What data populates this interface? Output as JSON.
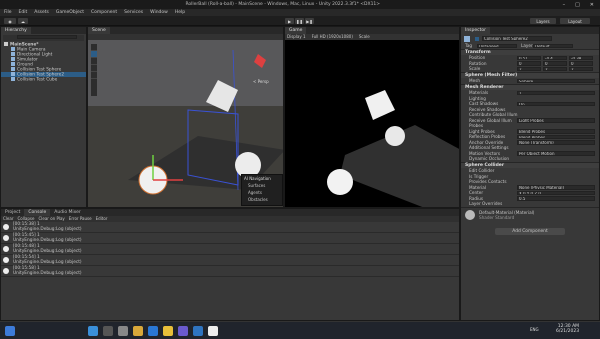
{
  "window": {
    "title": "RollerBall (Roll-a-ball) - MainScene - Windows, Mac, Linux - Unity 2022.3.3f1* <DX11>"
  },
  "menu": [
    "File",
    "Edit",
    "Assets",
    "GameObject",
    "Component",
    "Services",
    "Window",
    "Help"
  ],
  "toolbar": {
    "account": "Layers",
    "layout": "Layout"
  },
  "hierarchy": {
    "tab": "Hierarchy",
    "scene": "MainScene*",
    "items": [
      "Main Camera",
      "Directional Light",
      "Simulator",
      "Ground",
      "Collision Test Sphere",
      "Collision Test Sphere2",
      "Collision Test Cube"
    ],
    "selected": 5
  },
  "scene_view": {
    "tab": "Scene",
    "persp": "< Persp",
    "nav_overlay": {
      "title": "AI Navigation",
      "items": [
        "Surfaces",
        "Agents",
        "Obstacles"
      ]
    }
  },
  "game_view": {
    "tab": "Game",
    "display": "Display 1",
    "res": "Full HD (1920x1080)",
    "scale": "Scale"
  },
  "console": {
    "tabs": [
      "Project",
      "Console",
      "Audio Mixer"
    ],
    "toolbar": [
      "Clear",
      "Collapse",
      "Clear on Play",
      "Error Pause",
      "Editor"
    ],
    "logs": [
      {
        "time": "[00:15:38] 1",
        "msg": "UnityEngine.Debug:Log (object)"
      },
      {
        "time": "[00:15:45] 1",
        "msg": "UnityEngine.Debug:Log (object)"
      },
      {
        "time": "[00:15:48] 1",
        "msg": "UnityEngine.Debug:Log (object)"
      },
      {
        "time": "[00:15:54] 1",
        "msg": "UnityEngine.Debug:Log (object)"
      },
      {
        "time": "[00:15:58] 1",
        "msg": "UnityEngine.Debug:Log (object)"
      }
    ]
  },
  "inspector": {
    "tab": "Inspector",
    "object_name": "Collision Test Sphere2",
    "tag": "Untagged",
    "layer": "Default",
    "transform": {
      "title": "Transform",
      "position": [
        "0.51",
        "-4.4",
        "-0.38"
      ],
      "rotation": [
        "0",
        "0",
        "0"
      ],
      "scale": [
        "2",
        "2",
        "2"
      ]
    },
    "mesh_filter": {
      "title": "Sphere (Mesh Filter)",
      "mesh": "Sphere"
    },
    "mesh_renderer": {
      "title": "Mesh Renderer",
      "rows": [
        [
          "Materials",
          "1"
        ],
        [
          "Lighting",
          ""
        ],
        [
          "Cast Shadows",
          "On"
        ],
        [
          "Receive Shadows",
          ""
        ],
        [
          "Contribute Global Illum",
          ""
        ],
        [
          "Receive Global Illum",
          "Light Probes"
        ],
        [
          "Probes",
          ""
        ],
        [
          "Light Probes",
          "Blend Probes"
        ],
        [
          "Reflection Probes",
          "Blend Probes"
        ],
        [
          "Anchor Override",
          "None (Transform)"
        ],
        [
          "Additional Settings",
          ""
        ],
        [
          "Motion Vectors",
          "Per Object Motion"
        ],
        [
          "Dynamic Occlusion",
          ""
        ]
      ]
    },
    "sphere_collider": {
      "title": "Sphere Collider",
      "rows": [
        [
          "Edit Collider",
          ""
        ],
        [
          "Is Trigger",
          ""
        ],
        [
          "Provides Contacts",
          ""
        ],
        [
          "Material",
          "None (Physic Material)"
        ],
        [
          "Center",
          "X 0   Y 0   Z 0"
        ],
        [
          "Radius",
          "0.5"
        ],
        [
          "Layer Overrides",
          ""
        ]
      ]
    },
    "material": {
      "name": "Default-Material (Material)",
      "shader": "Standard"
    },
    "add_component": "Add Component"
  },
  "taskbar": {
    "time": "12:30 AM",
    "date": "6/21/2023",
    "lang": "ENG"
  }
}
